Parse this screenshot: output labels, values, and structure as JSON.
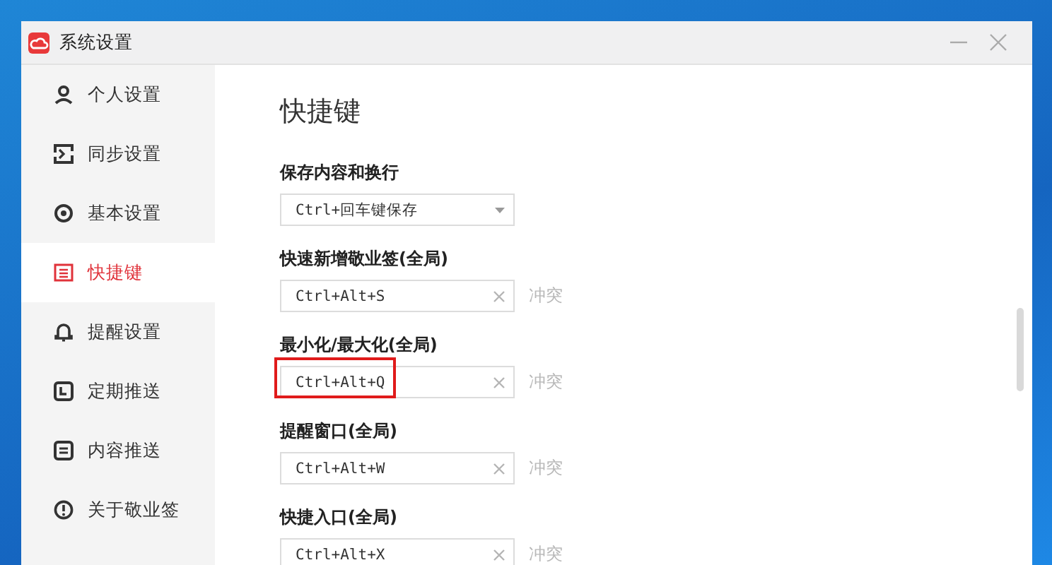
{
  "window": {
    "title": "系统设置"
  },
  "sidebar": {
    "items": [
      {
        "label": "个人设置",
        "selected": false
      },
      {
        "label": "同步设置",
        "selected": false
      },
      {
        "label": "基本设置",
        "selected": false
      },
      {
        "label": "快捷键",
        "selected": true
      },
      {
        "label": "提醒设置",
        "selected": false
      },
      {
        "label": "定期推送",
        "selected": false
      },
      {
        "label": "内容推送",
        "selected": false
      },
      {
        "label": "关于敬业签",
        "selected": false
      }
    ]
  },
  "content": {
    "heading": "快捷键",
    "settings": [
      {
        "kind": "select",
        "label": "保存内容和换行",
        "value": "Ctrl+回车键保存"
      },
      {
        "kind": "shortcut",
        "label": "快速新增敬业签(全局)",
        "value": "Ctrl+Alt+S",
        "status": "冲突",
        "highlighted": false
      },
      {
        "kind": "shortcut",
        "label": "最小化/最大化(全局)",
        "value": "Ctrl+Alt+Q",
        "status": "冲突",
        "highlighted": true
      },
      {
        "kind": "shortcut",
        "label": "提醒窗口(全局)",
        "value": "Ctrl+Alt+W",
        "status": "冲突",
        "highlighted": false
      },
      {
        "kind": "shortcut",
        "label": "快捷入口(全局)",
        "value": "Ctrl+Alt+X",
        "status": "冲突",
        "highlighted": false
      }
    ]
  }
}
